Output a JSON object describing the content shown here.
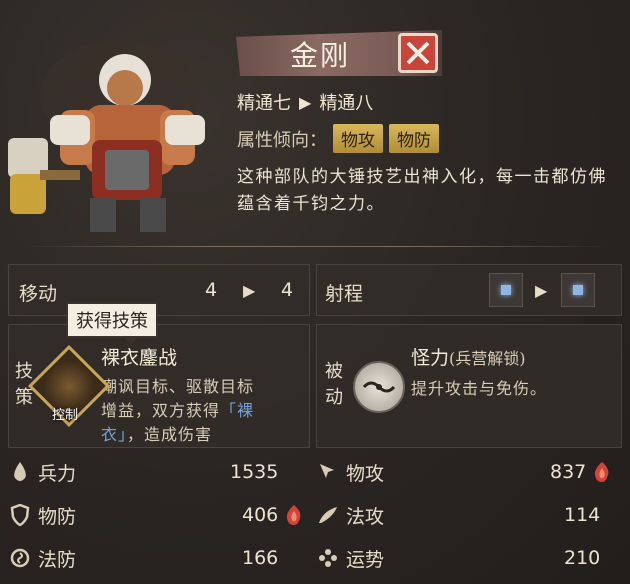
{
  "unit": {
    "name": "金刚",
    "mastery_from": "精通七",
    "mastery_to": "精通八",
    "attr_label": "属性倾向：",
    "tags": [
      "物攻",
      "物防"
    ],
    "description": "这种部队的大锤技艺出神入化，每一击都仿佛蕴含着千钧之力。"
  },
  "move": {
    "label": "移动",
    "from": "4",
    "to": "4"
  },
  "range": {
    "label": "射程"
  },
  "tactic": {
    "tooltip": "获得技策",
    "side_label": "技策",
    "icon_label": "控制",
    "name": "裸衣鏖战",
    "desc_1": "嘲讽目标、驱散目标",
    "desc_2": "增益，双方获得",
    "desc_highlight_a": "「裸",
    "desc_highlight_b": "衣」",
    "desc_3": "，造成伤害"
  },
  "passive": {
    "side_label": "被动",
    "name": "怪力",
    "note": "(兵营解锁)",
    "desc": "提升攻击与免伤。"
  },
  "stats": {
    "troops": {
      "label": "兵力",
      "value": "1535"
    },
    "phys_atk": {
      "label": "物攻",
      "value": "837"
    },
    "phys_def": {
      "label": "物防",
      "value": "406"
    },
    "mag_atk": {
      "label": "法攻",
      "value": "114"
    },
    "mag_def": {
      "label": "法防",
      "value": "166"
    },
    "luck": {
      "label": "运势",
      "value": "210"
    }
  },
  "colors": {
    "highlight": "#6fa3e0",
    "tag": "#c9a44a",
    "badge": "#d1443a"
  }
}
